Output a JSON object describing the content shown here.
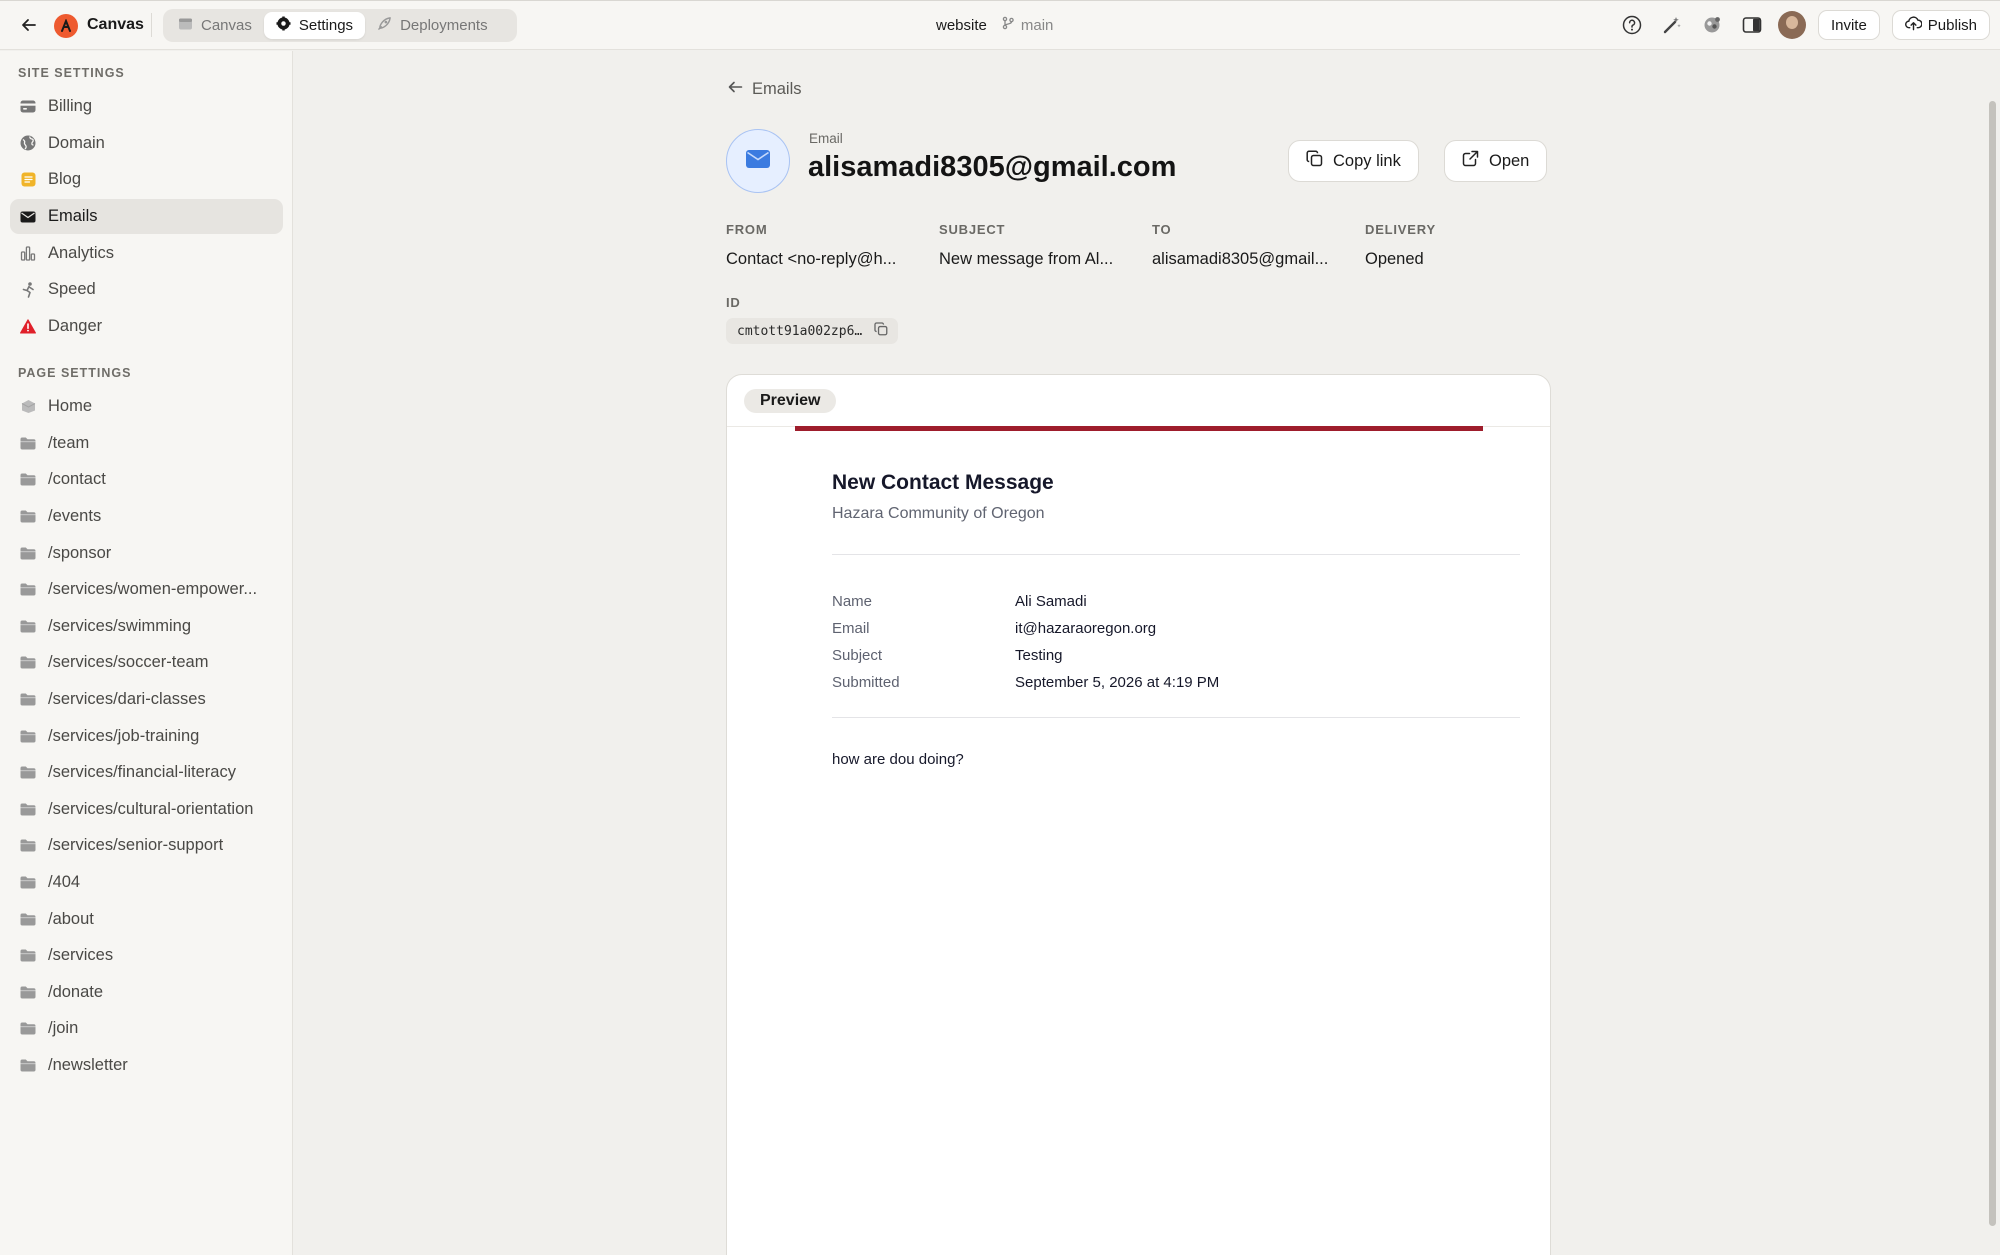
{
  "topbar": {
    "app_name": "Canvas",
    "tabs": [
      {
        "label": "Canvas",
        "icon": "browser-window-icon",
        "active": false
      },
      {
        "label": "Settings",
        "icon": "gear-icon",
        "active": true
      },
      {
        "label": "Deployments",
        "icon": "rocket-icon",
        "active": false
      }
    ],
    "site_name": "website",
    "branch": "main",
    "invite_label": "Invite",
    "publish_label": "Publish"
  },
  "sidebar": {
    "site_settings_title": "SITE SETTINGS",
    "site_items": [
      {
        "label": "Billing",
        "icon": "credit-card-icon",
        "active": false
      },
      {
        "label": "Domain",
        "icon": "globe-icon",
        "active": false
      },
      {
        "label": "Blog",
        "icon": "blog-icon",
        "active": false
      },
      {
        "label": "Emails",
        "icon": "envelope-icon",
        "active": true
      },
      {
        "label": "Analytics",
        "icon": "bar-chart-icon",
        "active": false
      },
      {
        "label": "Speed",
        "icon": "speed-icon",
        "active": false
      },
      {
        "label": "Danger",
        "icon": "warning-icon",
        "active": false
      }
    ],
    "page_settings_title": "PAGE SETTINGS",
    "page_items": [
      {
        "label": "Home",
        "icon": "home-icon"
      },
      {
        "label": "/team",
        "icon": "folder-icon"
      },
      {
        "label": "/contact",
        "icon": "folder-icon"
      },
      {
        "label": "/events",
        "icon": "folder-icon"
      },
      {
        "label": "/sponsor",
        "icon": "folder-icon"
      },
      {
        "label": "/services/women-empower...",
        "icon": "folder-icon"
      },
      {
        "label": "/services/swimming",
        "icon": "folder-icon"
      },
      {
        "label": "/services/soccer-team",
        "icon": "folder-icon"
      },
      {
        "label": "/services/dari-classes",
        "icon": "folder-icon"
      },
      {
        "label": "/services/job-training",
        "icon": "folder-icon"
      },
      {
        "label": "/services/financial-literacy",
        "icon": "folder-icon"
      },
      {
        "label": "/services/cultural-orientation",
        "icon": "folder-icon"
      },
      {
        "label": "/services/senior-support",
        "icon": "folder-icon"
      },
      {
        "label": "/404",
        "icon": "folder-icon"
      },
      {
        "label": "/about",
        "icon": "folder-icon"
      },
      {
        "label": "/services",
        "icon": "folder-icon"
      },
      {
        "label": "/donate",
        "icon": "folder-icon"
      },
      {
        "label": "/join",
        "icon": "folder-icon"
      },
      {
        "label": "/newsletter",
        "icon": "folder-icon"
      }
    ]
  },
  "detail": {
    "back_label": "Emails",
    "kicker": "Email",
    "title": "alisamadi8305@gmail.com",
    "copy_link_label": "Copy link",
    "open_label": "Open",
    "meta": [
      {
        "key": "FROM",
        "value": "Contact <no-reply@h..."
      },
      {
        "key": "SUBJECT",
        "value": "New message from Al..."
      },
      {
        "key": "TO",
        "value": "alisamadi8305@gmail..."
      },
      {
        "key": "DELIVERY",
        "value": "Opened"
      }
    ],
    "id_label": "ID",
    "id_value": "cmtott91a002zp6…"
  },
  "preview": {
    "tab_label": "Preview",
    "accent_color": "#9e1d2c",
    "title": "New Contact Message",
    "subtitle": "Hazara Community of Oregon",
    "rows": [
      {
        "key": "Name",
        "value": "Ali Samadi"
      },
      {
        "key": "Email",
        "value": "it@hazaraoregon.org"
      },
      {
        "key": "Subject",
        "value": "Testing"
      },
      {
        "key": "Submitted",
        "value": "September 5, 2026 at 4:19 PM"
      }
    ],
    "body": "how are dou doing?"
  }
}
